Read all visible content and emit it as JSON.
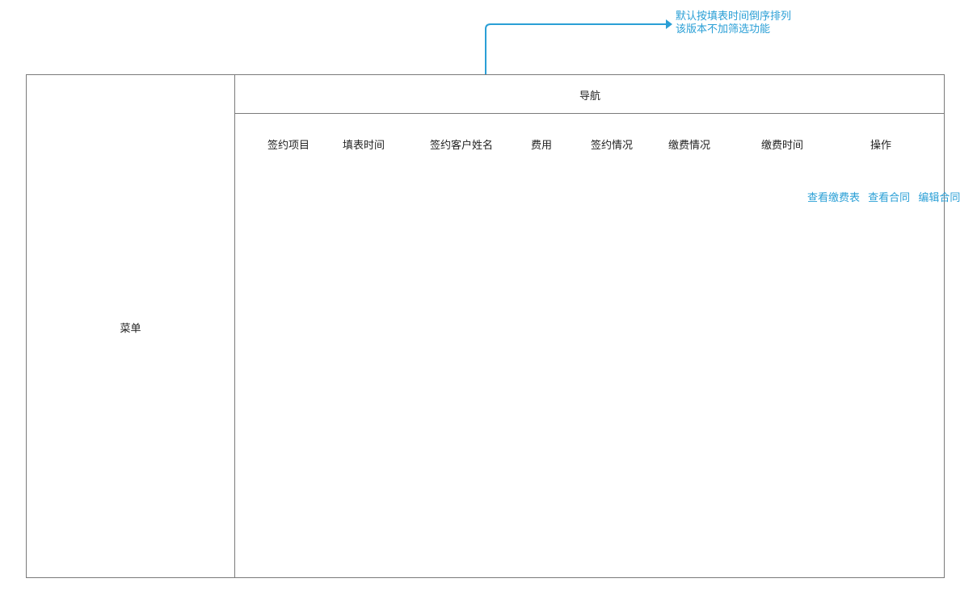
{
  "menu": {
    "label": "菜单"
  },
  "nav": {
    "label": "导航"
  },
  "table": {
    "columns": [
      "签约项目",
      "填表时间",
      "签约客户姓名",
      "费用",
      "签约情况",
      "缴费情况",
      "缴费时间",
      "操作"
    ],
    "actions": [
      "查看缴费表",
      "查看合同",
      "编辑合同"
    ]
  },
  "note": {
    "line1": "默认按填表时间倒序排列",
    "line2": "该版本不加筛选功能"
  },
  "colors": {
    "accent": "#2a9fd6",
    "border": "#7a7a7a"
  }
}
